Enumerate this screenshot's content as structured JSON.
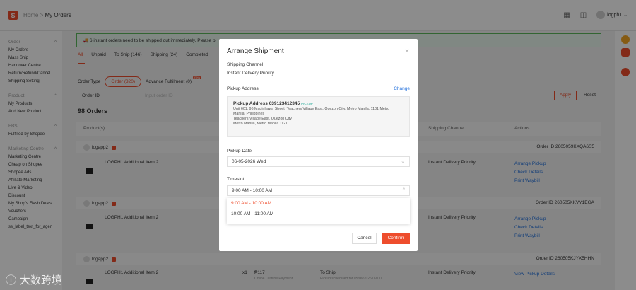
{
  "header": {
    "home": "Home",
    "separator": ">",
    "page": "My Orders",
    "user": "logph1"
  },
  "sidebar": {
    "sections": [
      {
        "title": "Order",
        "items": [
          "My Orders",
          "Mass Ship",
          "Handover Centre",
          "Return/Refund/Cancel",
          "Shipping Setting"
        ]
      },
      {
        "title": "Product",
        "items": [
          "My Products",
          "Add New Product"
        ]
      },
      {
        "title": "FBS",
        "items": [
          "Fulfilled by Shopee"
        ]
      },
      {
        "title": "Marketing Centre",
        "items": [
          "Marketing Centre",
          "Cheap on Shopee",
          "Shopee Ads",
          "Affiliate Marketing",
          "Live & Video",
          "Discount",
          "My Shop's Flash Deals",
          "Vouchers",
          "Campaign",
          "ss_label_text_for_agen"
        ]
      }
    ]
  },
  "main": {
    "alert": "6 instant orders need to be shipped out immediately. Please p",
    "tabs": [
      "All",
      "Unpaid",
      "To Ship (146)",
      "Shipping (24)",
      "Completed"
    ],
    "order_type_label": "Order Type",
    "order_type_pill": "Order (320)",
    "advance_fulfilment": "Advance Fulfilment (0)",
    "filter_select": "Order ID",
    "filter_placeholder": "Input order ID",
    "apply": "Apply",
    "reset": "Reset",
    "orders_count": "98 Orders",
    "columns": {
      "product": "Product(s)",
      "channel": "Shipping Channel",
      "actions": "Actions"
    },
    "orders": [
      {
        "user": "logapp2",
        "order_id": "Order ID 2605059KXQA6S5",
        "product": "LOGPH1 Additional Item 2",
        "channel": "Instant Delivery Priority",
        "actions": [
          "Arrange Pickup",
          "Check Details",
          "Print Waybill"
        ]
      },
      {
        "user": "logapp2",
        "order_id": "Order ID 260505KKVY1EGA",
        "product": "LOGPH1 Additional Item 2",
        "channel": "Instant Delivery Priority",
        "actions": [
          "Arrange Pickup",
          "Check Details",
          "Print Waybill"
        ]
      },
      {
        "user": "logapp2",
        "order_id": "Order ID 260505KJYX5HHN",
        "product": "LOGPH1 Additional Item 2",
        "channel": "Instant Delivery Priority",
        "actions": [
          "View Pickup Details"
        ],
        "qty": "x1",
        "price": "₱117",
        "payment": "Online / Offline Payment",
        "status": "To Ship",
        "status_note": "Pickup scheduled for 05/06/2026 09:00"
      }
    ]
  },
  "modal": {
    "title": "Arrange Shipment",
    "close": "×",
    "shipping_channel_label": "Shipping Channel",
    "shipping_channel_value": "Instant Delivery Priority",
    "pickup_address_label": "Pickup Address",
    "change": "Change",
    "address": {
      "title": "Pickup Address  639123412345",
      "tag": "PICKUP",
      "lines": [
        "Unit 601, 96 Maginhawa Street, Teachers Village East, Quezon City, Metro Manila, 1101 Metro",
        "Manila, Philippines",
        "Teachers Village East, Quezon City",
        "Metro Manila, Metro Manila 1121"
      ]
    },
    "pickup_date_label": "Pickup Date",
    "pickup_date_value": "06-05-2026 Wed",
    "timeslot_label": "Timeslot",
    "timeslot_value": "9:00 AM - 10:00 AM",
    "timeslot_options": [
      "9:00 AM - 10:00 AM",
      "10:00 AM - 11:00 AM"
    ],
    "cancel": "Cancel",
    "confirm": "Confirm"
  },
  "watermark": "大数跨境",
  "colors": {
    "accent": "#ee4d2d",
    "link": "#2673dd",
    "success": "#5cb85c"
  }
}
